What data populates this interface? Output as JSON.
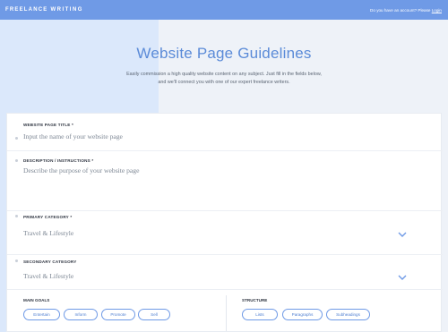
{
  "header": {
    "logo_part1": "FREELANCE",
    "logo_part2": "WRITING",
    "account_prompt": "Do you have an account? Please",
    "login_link": "Login"
  },
  "hero": {
    "title": "Website Page Guidelines",
    "subtitle_line1": "Easily commission a high quality website content on any subject. Just fill in the fields below,",
    "subtitle_line2": "and we'll connect you with one of our expert freelance writers."
  },
  "form": {
    "page_title": {
      "label": "WEBSITE PAGE TITLE *",
      "placeholder": "Input the name of your website page"
    },
    "description": {
      "label": "DESCRIPTION / INSTRUCTIONS *",
      "placeholder": "Describe the purpose of your website page"
    },
    "primary_category": {
      "label": "PRIMARY CATEGORY *",
      "value": "Travel & Lifestyle"
    },
    "secondary_category": {
      "label": "SECONDARY CATEGORY",
      "value": "Travel & Lifestyle"
    },
    "main_goals": {
      "label": "MAIN GOALS",
      "options": [
        "Entertain",
        "Inform",
        "Promote",
        "Sell"
      ]
    },
    "structure": {
      "label": "STRUCTURE",
      "options": [
        "Lists",
        "Paragraphs",
        "Subheadings"
      ]
    }
  },
  "colors": {
    "accent": "#6f9ae6",
    "title": "#5b8bd8"
  },
  "icons": {
    "dropdown": "chevron-down-icon"
  }
}
